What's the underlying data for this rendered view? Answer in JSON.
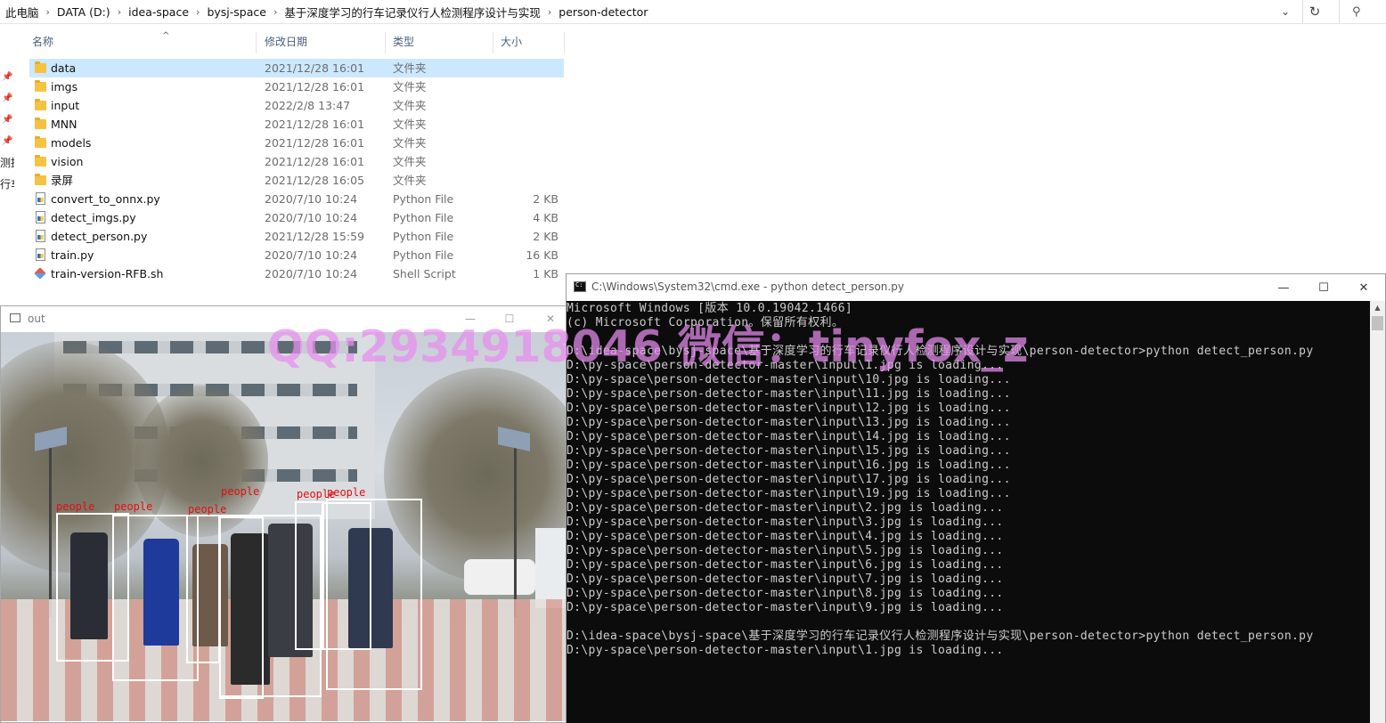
{
  "explorer": {
    "breadcrumb": [
      "此电脑",
      "DATA (D:)",
      "idea-space",
      "bysj-space",
      "基于深度学习的行车记录仪行人检测程序设计与实现",
      "person-detector"
    ],
    "columns": {
      "name": "名称",
      "date": "修改日期",
      "type": "类型",
      "size": "大小"
    },
    "nav_fragments": [
      "测据",
      "行车"
    ],
    "files": [
      {
        "name": "data",
        "date": "2021/12/28 16:01",
        "type": "文件夹",
        "size": "",
        "icon": "folder-icon"
      },
      {
        "name": "imgs",
        "date": "2021/12/28 16:01",
        "type": "文件夹",
        "size": "",
        "icon": "folder-icon"
      },
      {
        "name": "input",
        "date": "2022/2/8 13:47",
        "type": "文件夹",
        "size": "",
        "icon": "folder-icon"
      },
      {
        "name": "MNN",
        "date": "2021/12/28 16:01",
        "type": "文件夹",
        "size": "",
        "icon": "folder-icon"
      },
      {
        "name": "models",
        "date": "2021/12/28 16:01",
        "type": "文件夹",
        "size": "",
        "icon": "folder-icon"
      },
      {
        "name": "vision",
        "date": "2021/12/28 16:01",
        "type": "文件夹",
        "size": "",
        "icon": "folder-icon"
      },
      {
        "name": "录屏",
        "date": "2021/12/28 16:05",
        "type": "文件夹",
        "size": "",
        "icon": "folder-icon"
      },
      {
        "name": "convert_to_onnx.py",
        "date": "2020/7/10 10:24",
        "type": "Python File",
        "size": "2 KB",
        "icon": "python-file-icon"
      },
      {
        "name": "detect_imgs.py",
        "date": "2020/7/10 10:24",
        "type": "Python File",
        "size": "4 KB",
        "icon": "python-file-icon"
      },
      {
        "name": "detect_person.py",
        "date": "2021/12/28 15:59",
        "type": "Python File",
        "size": "2 KB",
        "icon": "python-file-icon"
      },
      {
        "name": "train.py",
        "date": "2020/7/10 10:24",
        "type": "Python File",
        "size": "16 KB",
        "icon": "python-file-icon"
      },
      {
        "name": "train-version-RFB.sh",
        "date": "2020/7/10 10:24",
        "type": "Shell Script",
        "size": "1 KB",
        "icon": "shell-script-icon"
      }
    ]
  },
  "image_window": {
    "title": "out",
    "detection_label": "people"
  },
  "cmd_window": {
    "title": "C:\\Windows\\System32\\cmd.exe - python  detect_person.py",
    "lines": [
      "Microsoft Windows [版本 10.0.19042.1466]",
      "(c) Microsoft Corporation。保留所有权利。",
      "",
      "D:\\idea-space\\bysj-space\\基于深度学习的行车记录仪行人检测程序设计与实现\\person-detector>python detect_person.py",
      "D:\\py-space\\person-detector-master\\input\\1.jpg is loading...",
      "D:\\py-space\\person-detector-master\\input\\10.jpg is loading...",
      "D:\\py-space\\person-detector-master\\input\\11.jpg is loading...",
      "D:\\py-space\\person-detector-master\\input\\12.jpg is loading...",
      "D:\\py-space\\person-detector-master\\input\\13.jpg is loading...",
      "D:\\py-space\\person-detector-master\\input\\14.jpg is loading...",
      "D:\\py-space\\person-detector-master\\input\\15.jpg is loading...",
      "D:\\py-space\\person-detector-master\\input\\16.jpg is loading...",
      "D:\\py-space\\person-detector-master\\input\\17.jpg is loading...",
      "D:\\py-space\\person-detector-master\\input\\19.jpg is loading...",
      "D:\\py-space\\person-detector-master\\input\\2.jpg is loading...",
      "D:\\py-space\\person-detector-master\\input\\3.jpg is loading...",
      "D:\\py-space\\person-detector-master\\input\\4.jpg is loading...",
      "D:\\py-space\\person-detector-master\\input\\5.jpg is loading...",
      "D:\\py-space\\person-detector-master\\input\\6.jpg is loading...",
      "D:\\py-space\\person-detector-master\\input\\7.jpg is loading...",
      "D:\\py-space\\person-detector-master\\input\\8.jpg is loading...",
      "D:\\py-space\\person-detector-master\\input\\9.jpg is loading...",
      "",
      "D:\\idea-space\\bysj-space\\基于深度学习的行车记录仪行人检测程序设计与实现\\person-detector>python detect_person.py",
      "D:\\py-space\\person-detector-master\\input\\1.jpg is loading..."
    ]
  },
  "watermark": "QQ:2934918046 微信：tinyfox_z"
}
